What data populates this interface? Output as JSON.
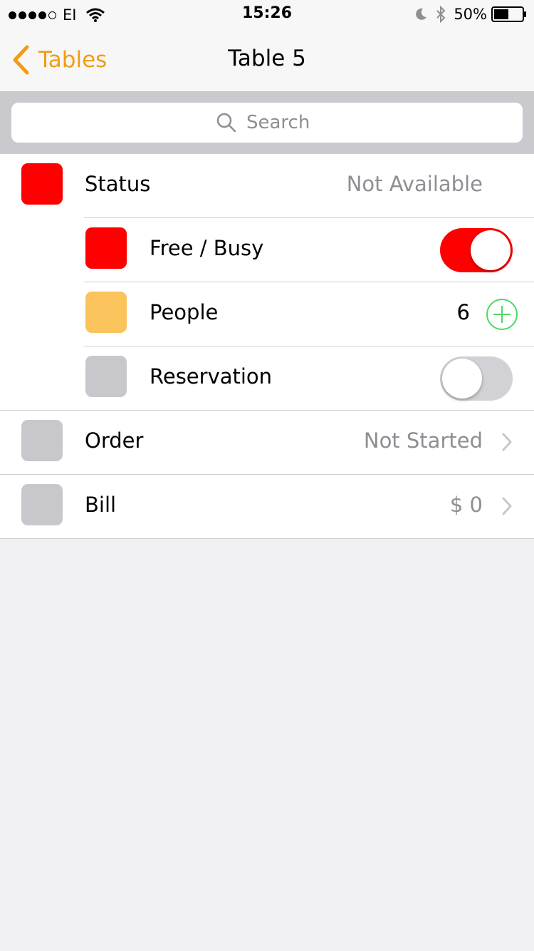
{
  "status_bar": {
    "carrier": "EI",
    "time": "15:26",
    "battery": "50%"
  },
  "nav": {
    "back_label": "Tables",
    "title": "Table 5"
  },
  "search": {
    "placeholder": "Search"
  },
  "rows": [
    {
      "label": "Status",
      "value": "Not Available",
      "swatch": "#ff0000"
    },
    {
      "label": "Free / Busy",
      "toggle": true,
      "swatch": "#ff0000"
    },
    {
      "label": "People",
      "count": "6",
      "swatch": "#fbc35c"
    },
    {
      "label": "Reservation",
      "toggle": false,
      "swatch": "#c8c8cc"
    },
    {
      "label": "Order",
      "value": "Not Started",
      "swatch": "#c8c8cc"
    },
    {
      "label": "Bill",
      "value": "$ 0",
      "swatch": "#c8c8cc"
    }
  ],
  "colors": {
    "accent": "#f39c12",
    "toggle_on": "#ff0000",
    "plus": "#4cd964"
  }
}
